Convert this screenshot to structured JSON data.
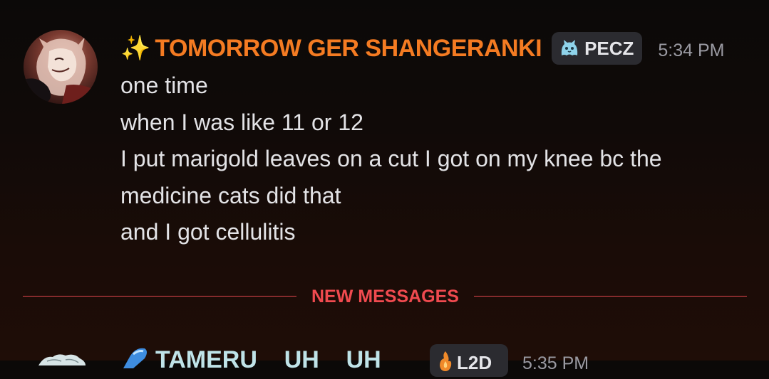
{
  "message": {
    "avatar_icon": "user-avatar",
    "decoration_emoji": "✨",
    "username": "TOMORROW GER SHANGERANKI",
    "username_color": "#f47b22",
    "role_tag": {
      "icon": "ghost-cat-icon",
      "label": "PECZ"
    },
    "timestamp": "5:34 PM",
    "lines": [
      "one time",
      "when I was like 11 or 12",
      "I put marigold leaves on a cut I got on my knee bc the",
      "medicine cats did that",
      "and I got cellulitis"
    ]
  },
  "divider": {
    "label": "NEW MESSAGES",
    "color": "#f04a4f"
  },
  "next_message": {
    "avatar_icon": "user-avatar",
    "decoration_icon": "blue-crystal-icon",
    "username": "TAMERU    UH    UH",
    "username_color": "#bfe3e8",
    "role_tag": {
      "icon": "flame-icon",
      "label": "L2D"
    },
    "timestamp": "5:35 PM"
  }
}
